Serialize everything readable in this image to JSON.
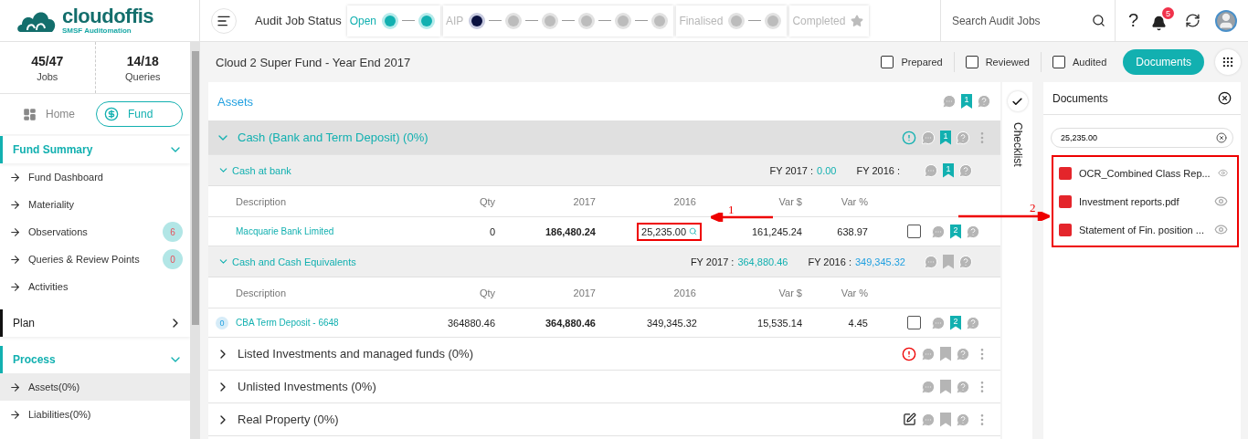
{
  "header": {
    "logo": {
      "name": "cloudoffis",
      "tagline": "SMSF Auditomation"
    },
    "status_label": "Audit Job Status",
    "stages": [
      {
        "label": "Open",
        "active": true,
        "kind": "dots",
        "steps": [
          {
            "done": true,
            "current": false
          },
          {
            "done": true,
            "current": false
          }
        ]
      },
      {
        "label": "AIP",
        "active": false,
        "kind": "dots",
        "steps": [
          {
            "done": false,
            "current": true
          },
          {
            "done": false,
            "current": false
          },
          {
            "done": false,
            "current": false
          },
          {
            "done": false,
            "current": false
          },
          {
            "done": false,
            "current": false
          },
          {
            "done": false,
            "current": false
          }
        ]
      },
      {
        "label": "Finalised",
        "active": false,
        "kind": "dots",
        "steps": [
          {
            "done": false,
            "current": false
          },
          {
            "done": false,
            "current": false
          }
        ]
      },
      {
        "label": "Completed",
        "active": false,
        "kind": "star"
      }
    ],
    "search": {
      "placeholder": "Search Audit Jobs"
    },
    "help": "?",
    "notifications": "5"
  },
  "sidebar": {
    "stats": [
      {
        "value": "45/47",
        "label": "Jobs"
      },
      {
        "value": "14/18",
        "label": "Queries"
      }
    ],
    "tabs": [
      {
        "label": "Home",
        "selected": false
      },
      {
        "label": "Fund",
        "selected": true
      }
    ],
    "sections": [
      {
        "title": "Fund Summary",
        "expanded": true,
        "items": [
          {
            "label": "Fund Dashboard",
            "selected": false
          },
          {
            "label": "Materiality",
            "selected": false
          },
          {
            "label": "Observations",
            "badge": "6",
            "selected": false
          },
          {
            "label": "Queries & Review Points",
            "badge": "0",
            "selected": false
          },
          {
            "label": "Activities",
            "selected": false
          }
        ]
      },
      {
        "title": "Plan",
        "expanded": false
      },
      {
        "title": "Process",
        "expanded": true,
        "items": [
          {
            "label": "Assets(0%)",
            "selected": true
          },
          {
            "label": "Liabilities(0%)",
            "selected": false
          }
        ]
      }
    ]
  },
  "main": {
    "title": "Cloud 2 Super Fund - Year End 2017",
    "signoffs": [
      {
        "label": "Prepared",
        "checked": false
      },
      {
        "label": "Reviewed",
        "checked": false
      },
      {
        "label": "Audited",
        "checked": false
      }
    ],
    "documents_button": "Documents"
  },
  "assets": {
    "title": "Assets",
    "bookmark": "1",
    "groups": [
      {
        "title": "Cash (Bank and Term Deposit) (0%)",
        "expanded": true,
        "alert": true,
        "warning": false,
        "bookmark": "1",
        "subgroups": [
          {
            "title": "Cash at bank",
            "fy_current_label": "FY 2017 :",
            "fy_current": "0.00",
            "fy_prior_label": "FY 2016 :",
            "bookmark": "1",
            "columns": [
              "Description",
              "Qty",
              "2017",
              "2016",
              "Var $",
              "Var %"
            ],
            "rows": [
              {
                "description": "Macquarie Bank Limited",
                "qty": "0",
                "y2017": "186,480.24",
                "y2016": "25,235.00",
                "var_amount": "161,245.24",
                "var_pct": "638.97",
                "checked": false,
                "bookmark": "2",
                "highlighted": true
              }
            ]
          },
          {
            "title": "Cash and Cash Equivalents",
            "fy_current_label": "FY 2017 :",
            "fy_current": "364,880.46",
            "fy_prior_label": "FY 2016 :",
            "fy_prior": "349,345.32",
            "columns": [
              "Description",
              "Qty",
              "2017",
              "2016",
              "Var $",
              "Var %"
            ],
            "rows": [
              {
                "badge": "0",
                "description": "CBA Term Deposit - 6648",
                "qty": "364880.46",
                "y2017": "364,880.46",
                "y2016": "349,345.32",
                "var_amount": "15,535.14",
                "var_pct": "4.45",
                "checked": false,
                "bookmark": "2",
                "highlighted": false
              }
            ]
          }
        ]
      },
      {
        "title": "Listed Investments and managed funds (0%)",
        "expanded": false,
        "alert": true,
        "warning": true
      },
      {
        "title": "Unlisted Investments (0%)",
        "expanded": false
      },
      {
        "title": "Real Property (0%)",
        "expanded": false,
        "note_icon": true
      }
    ]
  },
  "checklist": {
    "label": "Checklist"
  },
  "documents": {
    "title": "Documents",
    "search_value": "25,235.00",
    "highlighted": true,
    "files": [
      {
        "name": "OCR_Combined Class Rep..."
      },
      {
        "name": "Investment reports.pdf"
      },
      {
        "name": "Statement of Fin. position ..."
      }
    ]
  },
  "annotations": [
    {
      "label": "1"
    },
    {
      "label": "2"
    }
  ]
}
